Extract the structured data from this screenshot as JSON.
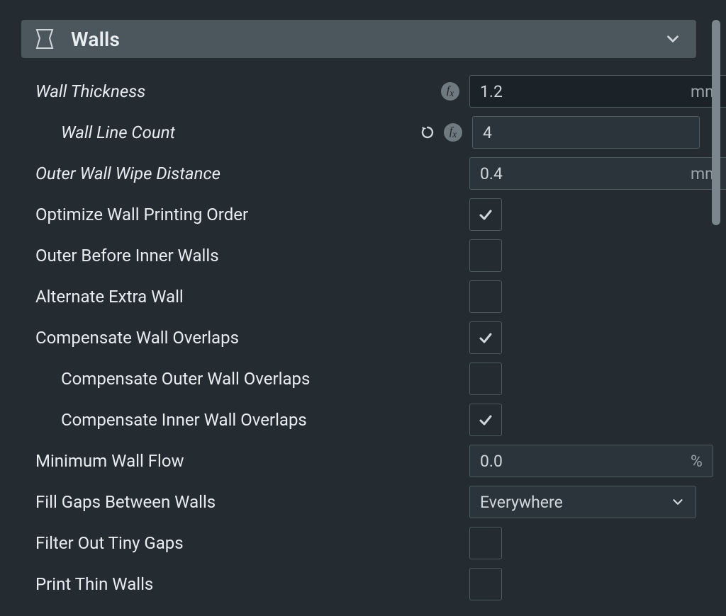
{
  "section": {
    "title": "Walls"
  },
  "rows": {
    "wall_thickness": {
      "label": "Wall Thickness",
      "value": "1.2",
      "unit": "mm"
    },
    "wall_line_count": {
      "label": "Wall Line Count",
      "value": "4"
    },
    "outer_wall_wipe": {
      "label": "Outer Wall Wipe Distance",
      "value": "0.4",
      "unit": "mm"
    },
    "optimize_order": {
      "label": "Optimize Wall Printing Order",
      "checked": true
    },
    "outer_before_inner": {
      "label": "Outer Before Inner Walls",
      "checked": false
    },
    "alternate_extra": {
      "label": "Alternate Extra Wall",
      "checked": false
    },
    "compensate_overlaps": {
      "label": "Compensate Wall Overlaps",
      "checked": true
    },
    "compensate_outer": {
      "label": "Compensate Outer Wall Overlaps",
      "checked": false
    },
    "compensate_inner": {
      "label": "Compensate Inner Wall Overlaps",
      "checked": true
    },
    "min_wall_flow": {
      "label": "Minimum Wall Flow",
      "value": "0.0",
      "unit": "%"
    },
    "fill_gaps": {
      "label": "Fill Gaps Between Walls",
      "value": "Everywhere"
    },
    "filter_tiny_gaps": {
      "label": "Filter Out Tiny Gaps",
      "checked": false
    },
    "print_thin_walls": {
      "label": "Print Thin Walls",
      "checked": false
    }
  }
}
